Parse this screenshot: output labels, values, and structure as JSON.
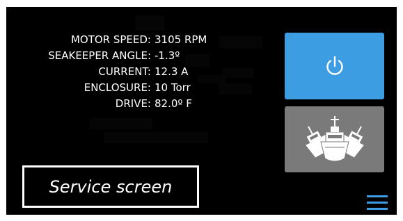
{
  "readouts": [
    {
      "label": "MOTOR SPEED:",
      "value": "3105  RPM"
    },
    {
      "label": "SEAKEEPER ANGLE:",
      "value": "-1.3º"
    },
    {
      "label": "CURRENT:",
      "value": "12.3  A"
    },
    {
      "label": "ENCLOSURE:",
      "value": "10 Torr"
    },
    {
      "label": "DRIVE:",
      "value": "82.0º F"
    }
  ],
  "buttons": {
    "power_icon": "power-icon",
    "boat_icon": "boat-icon",
    "service_label": "Service screen",
    "menu_icon": "hamburger-menu-icon"
  },
  "colors": {
    "background": "#000000",
    "accent": "#3c9de2",
    "secondary_button": "#7a7a7a",
    "text": "#ffffff"
  }
}
